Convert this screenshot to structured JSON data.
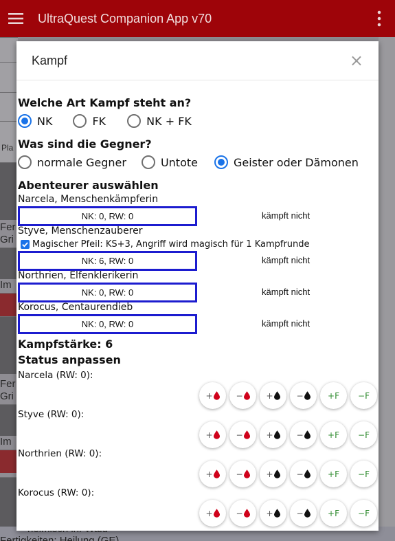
{
  "app": {
    "title": "UltraQuest Companion App v70"
  },
  "background": {
    "snippets": [
      "Pla",
      "Fer",
      "Gri",
      "Im",
      "Fer",
      "Gri",
      "Im"
    ],
    "bottom_line1": "heimisch in: Wald",
    "bottom_line2": "Fertigkeiten: Heilung (GE)"
  },
  "dialog": {
    "title": "Kampf",
    "close_symbol": "×",
    "fight_type": {
      "heading": "Welche Art Kampf steht an?",
      "options": [
        "NK",
        "FK",
        "NK + FK"
      ],
      "selected": "NK"
    },
    "enemies": {
      "heading": "Was sind die Gegner?",
      "options": [
        "normale Gegner",
        "Untote",
        "Geister oder Dämonen"
      ],
      "selected": "Geister oder Dämonen"
    },
    "adventurers": {
      "heading": "Abenteurer auswählen",
      "items": [
        {
          "name": "Narcela, Menschenkämpferin",
          "values": "NK: 0, RW: 0",
          "state": "kämpft nicht"
        },
        {
          "name": "Styve, Menschenzauberer",
          "checkbox": "Magischer Pfeil: KS+3, Angriff wird magisch für 1 Kampfrunde",
          "values": "NK: 6, RW: 0",
          "state": "kämpft nicht"
        },
        {
          "name": "Northrien, Elfenklerikerin",
          "values": "NK: 0, RW: 0",
          "state": "kämpft nicht"
        },
        {
          "name": "Korocus, Centaurendieb",
          "values": "NK: 0, RW: 0",
          "state": "kämpft nicht"
        }
      ]
    },
    "strength": "Kampfstärke: 6",
    "status": {
      "heading": "Status anpassen",
      "rows": [
        "Narcela (RW: 0):",
        "Styve (RW: 0):",
        "Northrien (RW: 0):",
        "Korocus (RW: 0):"
      ],
      "buttons": {
        "plus": "+",
        "minus": "−",
        "plus_f": "+F",
        "minus_f": "−F"
      }
    }
  },
  "colors": {
    "appbar": "#9e0409",
    "accent": "#1a73e8",
    "box_border": "#1c1ccf",
    "blood": "#d0021b",
    "fate": "#2e8b2e"
  }
}
